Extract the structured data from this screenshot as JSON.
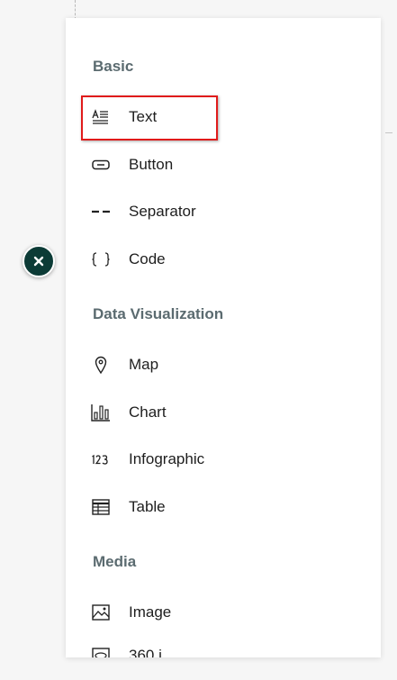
{
  "colors": {
    "accent_close_button": "#0c3b36",
    "section_title": "#5b6b70",
    "highlight": "#e01b1b",
    "text": "#1e1e1e"
  },
  "close_button": {
    "icon": "close-icon",
    "glyph": "✕"
  },
  "sections": {
    "basic": {
      "title": "Basic",
      "items": {
        "text": {
          "label": "Text",
          "icon": "text-block-icon"
        },
        "button": {
          "label": "Button",
          "icon": "button-icon"
        },
        "separator": {
          "label": "Separator",
          "icon": "separator-icon"
        },
        "code": {
          "label": "Code",
          "icon": "code-braces-icon"
        }
      }
    },
    "data_visualization": {
      "title": "Data Visualization",
      "items": {
        "map": {
          "label": "Map",
          "icon": "map-pin-icon"
        },
        "chart": {
          "label": "Chart",
          "icon": "bar-chart-icon"
        },
        "infographic": {
          "label": "Infographic",
          "icon": "number-123-icon"
        },
        "table": {
          "label": "Table",
          "icon": "table-icon"
        }
      }
    },
    "media": {
      "title": "Media",
      "items": {
        "image": {
          "label": "Image",
          "icon": "image-icon"
        },
        "image_360": {
          "label": "360 i",
          "icon": "image-360-icon"
        }
      }
    }
  },
  "highlighted_item": "Text"
}
